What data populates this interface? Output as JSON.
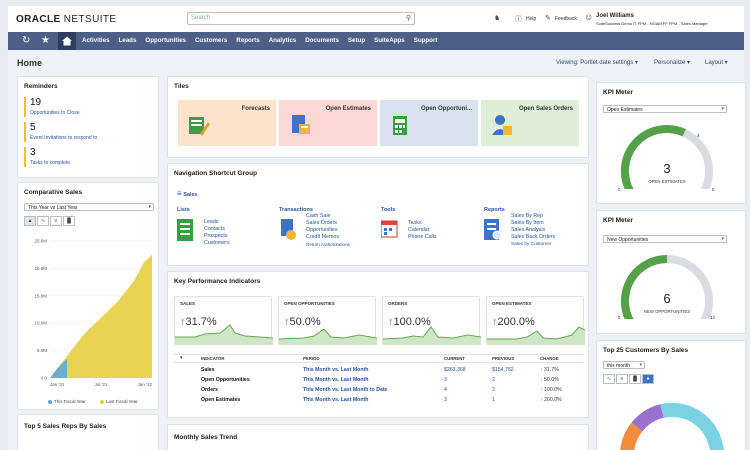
{
  "header": {
    "logo_bold": "ORACLE",
    "logo_light": " NETSUITE",
    "search_placeholder": "Search",
    "help": "Help",
    "feedback": "Feedback",
    "user_name": "Joel Williams",
    "user_role": "SuiteSuccess Demo IT FPM - NOAM FF FPM - Sales Manager"
  },
  "nav": {
    "items": [
      "Activities",
      "Leads",
      "Opportunities",
      "Customers",
      "Reports",
      "Analytics",
      "Documents",
      "Setup",
      "SuiteApps",
      "Support"
    ]
  },
  "page": {
    "title": "Home",
    "viewing": "Viewing: Portlet date settings",
    "personalize": "Personalize",
    "layout": "Layout"
  },
  "reminders": {
    "title": "Reminders",
    "items": [
      {
        "count": "19",
        "label": "Opportunities to Close"
      },
      {
        "count": "5",
        "label": "Event Invitations to respond to"
      },
      {
        "count": "3",
        "label": "Tasks to complete"
      }
    ]
  },
  "comparative_sales": {
    "title": "Comparative Sales",
    "period": "This Year vs Last Year",
    "legend_this": "This Fiscal Year",
    "legend_last": "Last Fiscal Year"
  },
  "top_reps": {
    "title": "Top 5 Sales Reps By Sales"
  },
  "tiles": {
    "title": "Tiles",
    "items": [
      {
        "label": "Forecasts",
        "bg": "#fbe3cc"
      },
      {
        "label": "Open Estimates",
        "bg": "#fbd9d6"
      },
      {
        "label": "Open Opportuni...",
        "bg": "#d9e3f0"
      },
      {
        "label": "Open Sales Orders",
        "bg": "#dfeed9"
      }
    ]
  },
  "nsg": {
    "title": "Navigation Shortcut Group",
    "menu": "Sales",
    "cols": [
      {
        "head": "Lists",
        "links": [
          "Leads",
          "Contacts",
          "Prospects",
          "Customers"
        ]
      },
      {
        "head": "Transactions",
        "links": [
          "Cash Sale",
          "Sales Orders",
          "Opportunities",
          "Credit Memos",
          "Return Authorizations"
        ]
      },
      {
        "head": "Tools",
        "links": [
          "Tasks",
          "Calendar",
          "Phone Calls"
        ]
      },
      {
        "head": "Reports",
        "links": [
          "Sales By Rep",
          "Sales By Item",
          "Sales Analysis",
          "Sales Back Orders",
          "Sales by Customer"
        ]
      }
    ]
  },
  "kpi": {
    "title": "Key Performance Indicators",
    "cards": [
      {
        "label": "SALES",
        "value": "31.7%"
      },
      {
        "label": "OPEN OPPORTUNITIES",
        "value": "50.0%"
      },
      {
        "label": "ORDERS",
        "value": "100.0%"
      },
      {
        "label": "OPEN ESTIMATES",
        "value": "200.0%"
      }
    ],
    "headers": {
      "indicator": "INDICATOR",
      "period": "PERIOD",
      "current": "CURRENT",
      "previous": "PREVIOUS",
      "change": "CHANGE"
    },
    "rows": [
      {
        "indicator": "Sales",
        "period": "This Month vs. Last Month",
        "current": "$263,368",
        "previous": "$154,782",
        "change": "31.7%"
      },
      {
        "indicator": "Open Opportunities",
        "period": "This Month vs. Last Month",
        "current": "3",
        "previous": "2",
        "change": "50.0%"
      },
      {
        "indicator": "Orders",
        "period": "This Month vs. Last Month to Date",
        "current": "4",
        "previous": "2",
        "change": "100.0%"
      },
      {
        "indicator": "Open Estimates",
        "period": "This Month vs. Last Month",
        "current": "3",
        "previous": "1",
        "change": "200.0%"
      }
    ]
  },
  "monthly": {
    "title": "Monthly Sales Trend"
  },
  "kpi_meter1": {
    "title": "KPI Meter",
    "select": "Open Estimates",
    "value": "3",
    "sub": "OPEN ESTIMATES",
    "min": "0",
    "max": "5",
    "mark": "4",
    "fraction": 0.6
  },
  "kpi_meter2": {
    "title": "KPI Meter",
    "select": "New Opportunities",
    "value": "6",
    "sub": "NEW OPPORTUNITIES",
    "min": "0",
    "max": "12",
    "fraction": 0.5
  },
  "top_customers": {
    "title": "Top 25 Customers By Sales",
    "period": "this month"
  },
  "chart_data": {
    "type": "area",
    "x": [
      "Jan '21",
      "Jul '21",
      "Jan '22"
    ],
    "yticks": [
      "25.0M",
      "20.0M",
      "15.0M",
      "10.0M",
      "5.0M",
      "0.0"
    ],
    "ylim": [
      0,
      25
    ],
    "series": [
      {
        "name": "This Fiscal Year",
        "color": "#5aa4e0",
        "values": [
          0,
          2,
          3.5,
          0,
          0,
          0,
          0,
          0,
          0,
          0,
          0,
          0,
          0
        ]
      },
      {
        "name": "Last Fiscal Year",
        "color": "#e6cf3d",
        "values": [
          0,
          2,
          4,
          6,
          8,
          9.5,
          11,
          12.5,
          14,
          16,
          18,
          21,
          22.5
        ]
      }
    ]
  }
}
